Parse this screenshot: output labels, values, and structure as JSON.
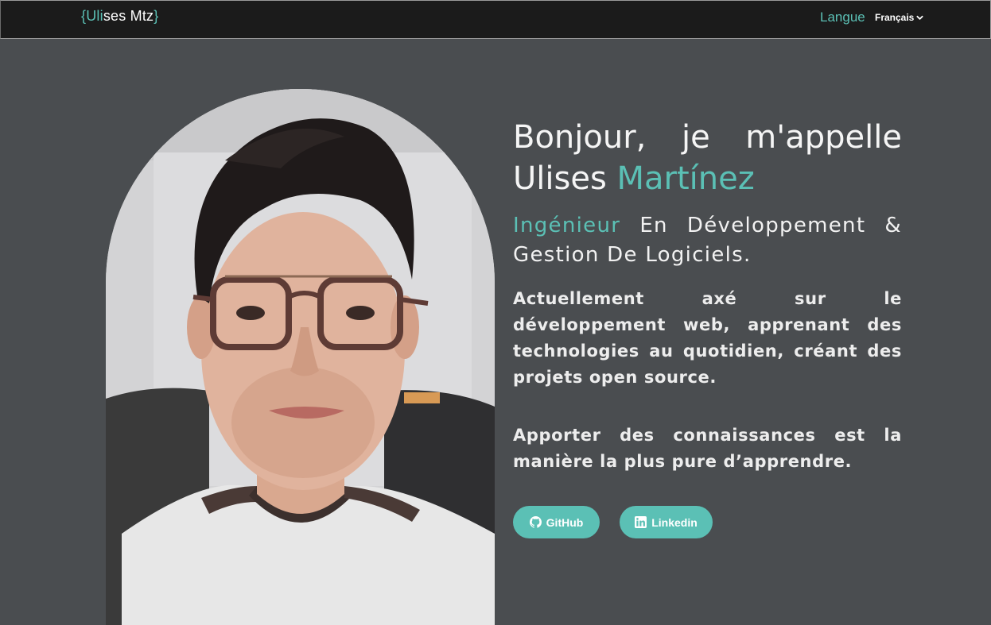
{
  "navbar": {
    "logo": {
      "open_brace": "{",
      "part1": "Uli",
      "part2": "ses Mtz",
      "close_brace": "}"
    },
    "language_label": "Langue",
    "language_selected": "Français"
  },
  "hero": {
    "greeting": "Bonjour, je m'appelle Ulises",
    "name_accent": "Martínez",
    "role_accent": "Ingénieur",
    "role_rest": "En Développement & Gestion De Logiciels.",
    "description": "Actuellement axé sur le développement web, apprenant des technologies au quotidien, créant des projets open source.",
    "quote": "Apporter des connaissances est la manière la plus pure d’apprendre.",
    "buttons": {
      "github": "GitHub",
      "linkedin": "Linkedin"
    }
  },
  "colors": {
    "accent": "#5bc0b5",
    "background": "#4a4d50",
    "navbar": "#1b1b1b"
  },
  "icons": [
    "chevron-down-icon",
    "github-icon",
    "linkedin-icon"
  ]
}
